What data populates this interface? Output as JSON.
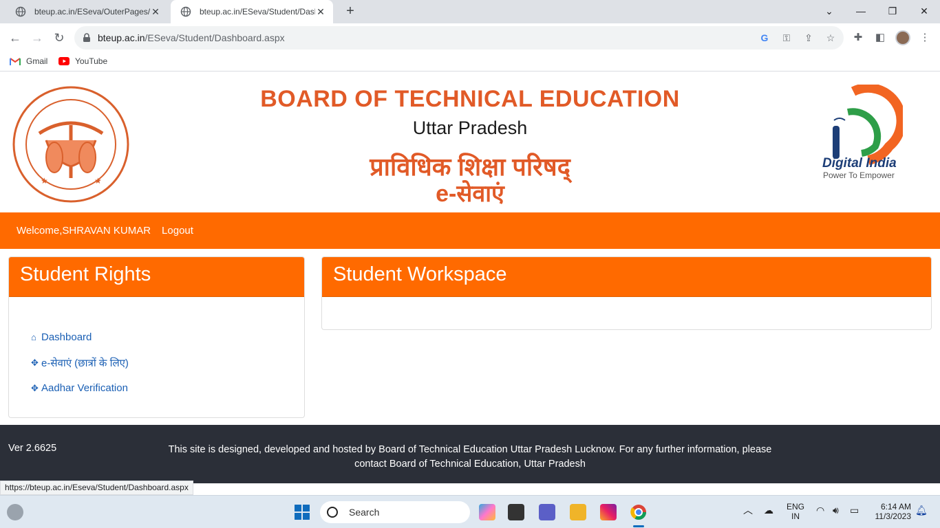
{
  "browser": {
    "tabs": [
      {
        "title": "bteup.ac.in/ESeva/OuterPages/S",
        "active": false
      },
      {
        "title": "bteup.ac.in/ESeva/Student/Dash",
        "active": true
      }
    ],
    "address_host": "bteup.ac.in",
    "address_path": "/ESeva/Student/Dashboard.aspx",
    "bookmarks": [
      {
        "label": "Gmail",
        "icon": "gmail-icon"
      },
      {
        "label": "YouTube",
        "icon": "youtube-icon"
      }
    ],
    "status_url": "https://bteup.ac.in/Eseva/Student/Dashboard.aspx"
  },
  "header": {
    "title": "BOARD OF TECHNICAL EDUCATION",
    "state": "Uttar Pradesh",
    "hindi_title": "प्राविधिक शिक्षा परिषद्",
    "hindi_subtitle": "e-सेवाएं",
    "logo_right_text": "Digital India",
    "logo_right_tagline": "Power To Empower",
    "accent_color": "#e15a27"
  },
  "nav": {
    "welcome": "Welcome,SHRAVAN KUMAR",
    "logout": "Logout",
    "bar_color": "#ff6a00"
  },
  "rights_panel": {
    "title": "Student Rights",
    "links": [
      {
        "label": "Dashboard",
        "icon": "home-icon"
      },
      {
        "label": "e-सेवाएं (छात्रों के लिए)",
        "icon": "move-icon"
      },
      {
        "label": "Aadhar Verification",
        "icon": "move-icon"
      }
    ]
  },
  "workspace_panel": {
    "title": "Student Workspace"
  },
  "footer": {
    "version": "Ver 2.6625",
    "text": "This site is designed, developed and hosted by Board of Technical Education Uttar Pradesh Lucknow. For any further information, please contact Board of Technical Education, Uttar Pradesh"
  },
  "taskbar": {
    "search_placeholder": "Search",
    "lang_top": "ENG",
    "lang_bottom": "IN",
    "time": "6:14 AM",
    "date": "11/3/2023"
  }
}
